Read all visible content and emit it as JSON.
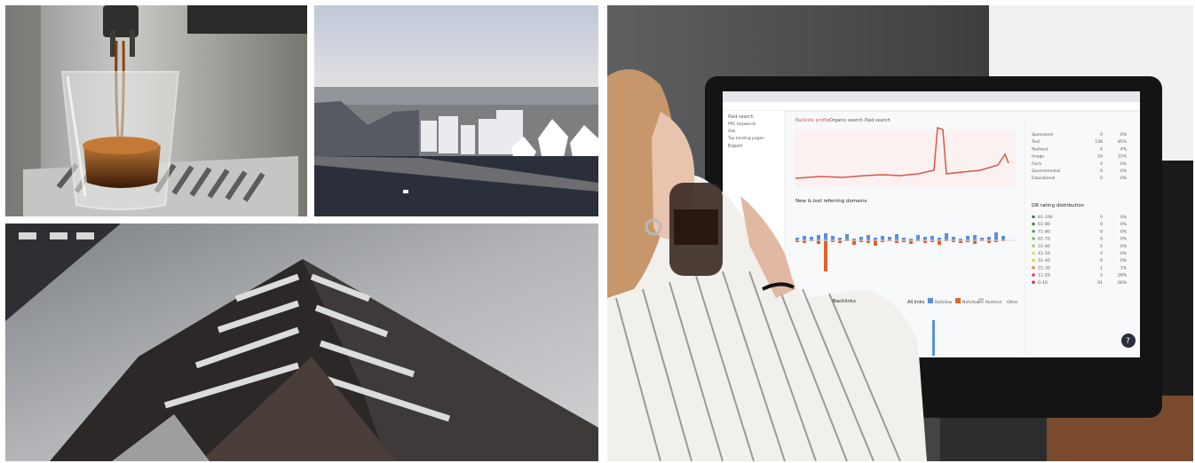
{
  "monitor": {
    "sidebar": [
      "Paid search",
      "PPC keywords",
      "Ads",
      "Top landing pages",
      "Export"
    ],
    "tabs": [
      "Backlink profile",
      "Organic search",
      "Paid search"
    ],
    "section_new_lost": "New & lost referring domains",
    "section_backlinks": "Backlinks",
    "legend": [
      "All links",
      "Dofollow",
      "Nofollow",
      "Redirect",
      "Other"
    ],
    "right_table": [
      {
        "label": "Sponsored",
        "count": "0",
        "pct": "0%"
      },
      {
        "label": "Text",
        "count": "136",
        "pct": "85%"
      },
      {
        "label": "Redirect",
        "count": "6",
        "pct": "4%"
      },
      {
        "label": "Image",
        "count": "24",
        "pct": "15%"
      },
      {
        "label": "Form",
        "count": "0",
        "pct": "0%"
      },
      {
        "label": "Governmental",
        "count": "0",
        "pct": "0%"
      },
      {
        "label": "Educational",
        "count": "0",
        "pct": "0%"
      }
    ],
    "dr_title": "DR rating distribution",
    "dr_table": [
      {
        "label": "81–100",
        "count": "0",
        "pct": "0%"
      },
      {
        "label": "61–80",
        "count": "0",
        "pct": "0%"
      },
      {
        "label": "71–80",
        "count": "0",
        "pct": "0%"
      },
      {
        "label": "61–70",
        "count": "0",
        "pct": "0%"
      },
      {
        "label": "51–60",
        "count": "0",
        "pct": "0%"
      },
      {
        "label": "41–50",
        "count": "0",
        "pct": "0%"
      },
      {
        "label": "31–40",
        "count": "0",
        "pct": "0%"
      },
      {
        "label": "21–30",
        "count": "1",
        "pct": "1%"
      },
      {
        "label": "11–20",
        "count": "5",
        "pct": "28%"
      },
      {
        "label": "0–10",
        "count": "91",
        "pct": "66%"
      }
    ],
    "help_glyph": "?"
  },
  "colors": {
    "monitor_frame": "#1a1a1a",
    "bar_blue": "#5a8fd8",
    "bar_orange": "#e0632a",
    "line_red": "#d9574a"
  }
}
